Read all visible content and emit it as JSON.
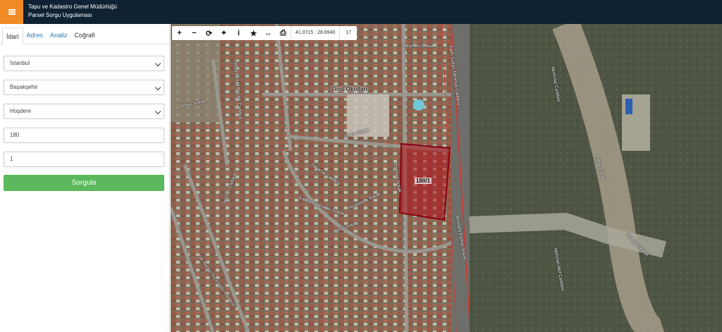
{
  "header": {
    "title_line1": "Tapu ve Kadastro Genel Müdürlüğü",
    "title_line2": "Parsel Sorgu Uygulaması"
  },
  "tabs": [
    {
      "label": "İdari"
    },
    {
      "label": "Adres"
    },
    {
      "label": "Analiz"
    },
    {
      "label": "Coğrafi"
    }
  ],
  "form": {
    "il": "İstanbul",
    "ilce": "Başakşehir",
    "mahalle": "Hoşdere",
    "ada": "180",
    "parsel": "1",
    "submit_label": "Sorgula"
  },
  "map_toolbar": {
    "icons": [
      "zoom-in-icon",
      "zoom-out-icon",
      "refresh-icon",
      "locate-icon",
      "info-icon",
      "star-icon",
      "measure-icon",
      "print-icon"
    ],
    "coords": "41.0715 : 28.6940",
    "zoom_level": "17"
  },
  "map": {
    "parcel_label": "180/1",
    "accent_parcel_color": "#b3101a",
    "street_labels": [
      "Seymen Sokak",
      "Final Okulları",
      "Fatih Sultan Mehmet Caddesi",
      "Simav Sokak",
      "Sakarya Caddesi",
      "Şeyhan Caddesi",
      "Yahya Kemal Beyatlı Caddesi",
      "Akıncılar Caddesi",
      "Gediz Sokak",
      "Parman Sokak",
      "Yenibosna Sokak",
      "Kahramanmaraş Sokak",
      "Hatay Sokak",
      "Mustafa Kemal Sokak",
      "Yalı Recep Yazıcıoğlu Caddesi",
      "Mehmet Akif Caddesi",
      "Maltepe Sokak",
      "Arifiye Sokak"
    ]
  }
}
